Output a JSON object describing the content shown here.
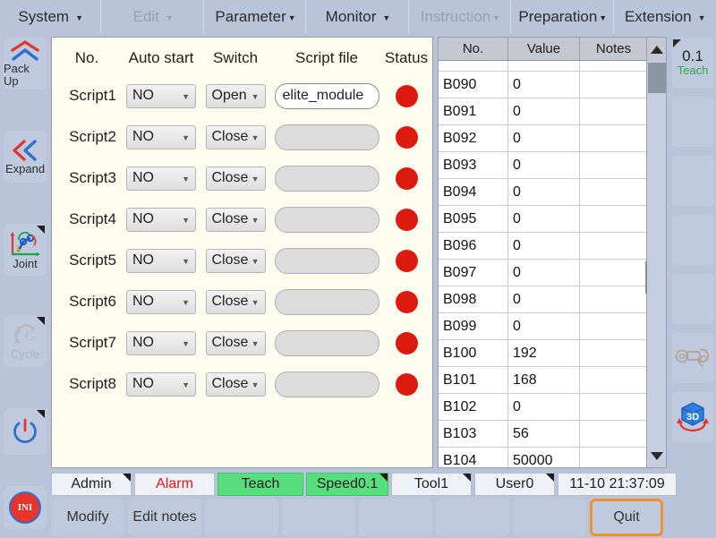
{
  "menubar": {
    "items": [
      {
        "label": "System",
        "caret": "▼",
        "disabled": false
      },
      {
        "label": "Edit",
        "caret": "▼",
        "disabled": true
      },
      {
        "label": "Parameter",
        "caret": "▼",
        "disabled": false
      },
      {
        "label": "Monitor",
        "caret": "▼",
        "disabled": false
      },
      {
        "label": "Instruction",
        "caret": "▼",
        "disabled": true
      },
      {
        "label": "Preparation",
        "caret": "▼",
        "disabled": false
      },
      {
        "label": "Extension",
        "caret": "▼",
        "disabled": false
      }
    ]
  },
  "left_rail": {
    "items": [
      {
        "label": "Pack Up",
        "icon": "chevron-up-double-icon",
        "dim": false,
        "corner": false
      },
      {
        "label": "Expand",
        "icon": "chevron-left-double-icon",
        "dim": false,
        "corner": false
      },
      {
        "label": "Joint",
        "icon": "robot-joint-icon",
        "dim": false,
        "corner": true
      },
      {
        "label": "Cycle",
        "icon": "cycle-icon",
        "dim": true,
        "corner": true
      },
      {
        "label": "",
        "icon": "power-icon",
        "dim": false,
        "corner": true
      }
    ],
    "ini_label": "INI"
  },
  "right_rail": {
    "speed": {
      "value": "0.1",
      "mode": "Teach"
    },
    "items": [
      {
        "icon": "teach-speed-icon"
      },
      {
        "icon": "blank-icon"
      },
      {
        "icon": "blank-icon"
      },
      {
        "icon": "blank-icon"
      },
      {
        "icon": "blank-icon"
      },
      {
        "icon": "teach-pendant-icon"
      },
      {
        "icon": "3d-view-icon"
      }
    ]
  },
  "script_panel": {
    "headers": [
      "No.",
      "Auto start",
      "Switch",
      "Script file",
      "Status"
    ],
    "rows": [
      {
        "no": "Script1",
        "auto_start": "NO",
        "switch": "Open",
        "file": "elite_module",
        "file_active": true,
        "status": "red"
      },
      {
        "no": "Script2",
        "auto_start": "NO",
        "switch": "Close",
        "file": "",
        "file_active": false,
        "status": "red"
      },
      {
        "no": "Script3",
        "auto_start": "NO",
        "switch": "Close",
        "file": "",
        "file_active": false,
        "status": "red"
      },
      {
        "no": "Script4",
        "auto_start": "NO",
        "switch": "Close",
        "file": "",
        "file_active": false,
        "status": "red"
      },
      {
        "no": "Script5",
        "auto_start": "NO",
        "switch": "Close",
        "file": "",
        "file_active": false,
        "status": "red"
      },
      {
        "no": "Script6",
        "auto_start": "NO",
        "switch": "Close",
        "file": "",
        "file_active": false,
        "status": "red"
      },
      {
        "no": "Script7",
        "auto_start": "NO",
        "switch": "Close",
        "file": "",
        "file_active": false,
        "status": "red"
      },
      {
        "no": "Script8",
        "auto_start": "NO",
        "switch": "Close",
        "file": "",
        "file_active": false,
        "status": "red"
      }
    ],
    "status_color": "#dd1a0e"
  },
  "data_table": {
    "headers": [
      "No.",
      "Value",
      "Notes"
    ],
    "rows": [
      {
        "no": "B090",
        "value": "0",
        "notes": ""
      },
      {
        "no": "B091",
        "value": "0",
        "notes": ""
      },
      {
        "no": "B092",
        "value": "0",
        "notes": ""
      },
      {
        "no": "B093",
        "value": "0",
        "notes": ""
      },
      {
        "no": "B094",
        "value": "0",
        "notes": ""
      },
      {
        "no": "B095",
        "value": "0",
        "notes": ""
      },
      {
        "no": "B096",
        "value": "0",
        "notes": ""
      },
      {
        "no": "B097",
        "value": "0",
        "notes": ""
      },
      {
        "no": "B098",
        "value": "0",
        "notes": ""
      },
      {
        "no": "B099",
        "value": "0",
        "notes": ""
      },
      {
        "no": "B100",
        "value": "192",
        "notes": ""
      },
      {
        "no": "B101",
        "value": "168",
        "notes": ""
      },
      {
        "no": "B102",
        "value": "0",
        "notes": ""
      },
      {
        "no": "B103",
        "value": "56",
        "notes": ""
      },
      {
        "no": "B104",
        "value": "50000",
        "notes": ""
      }
    ]
  },
  "statusbar": {
    "cells": [
      {
        "label": "Admin",
        "style": "plain",
        "corner": true
      },
      {
        "label": "Alarm",
        "style": "alarm",
        "corner": false
      },
      {
        "label": "Teach",
        "style": "green",
        "corner": false
      },
      {
        "label": "Speed0.1",
        "style": "green",
        "corner": true
      },
      {
        "label": "Tool1",
        "style": "plain",
        "corner": true
      },
      {
        "label": "User0",
        "style": "plain",
        "corner": true
      },
      {
        "label": "11-10 21:37:09",
        "style": "plain",
        "corner": false
      }
    ]
  },
  "bottom_buttons": [
    {
      "label": "Modify",
      "highlight": false
    },
    {
      "label": "Edit notes",
      "highlight": false
    },
    {
      "label": "",
      "highlight": false
    },
    {
      "label": "",
      "highlight": false
    },
    {
      "label": "",
      "highlight": false
    },
    {
      "label": "",
      "highlight": false
    },
    {
      "label": "",
      "highlight": false
    },
    {
      "label": "Quit",
      "highlight": true
    }
  ],
  "colors": {
    "chrome": "#b9c4da",
    "panel_cream": "#fdfdef",
    "accent_orange": "#f0912b",
    "status_green": "#59de7e",
    "alarm_red": "#e51717",
    "led_red": "#dd1a0e",
    "teach_green": "#2fa84f"
  }
}
